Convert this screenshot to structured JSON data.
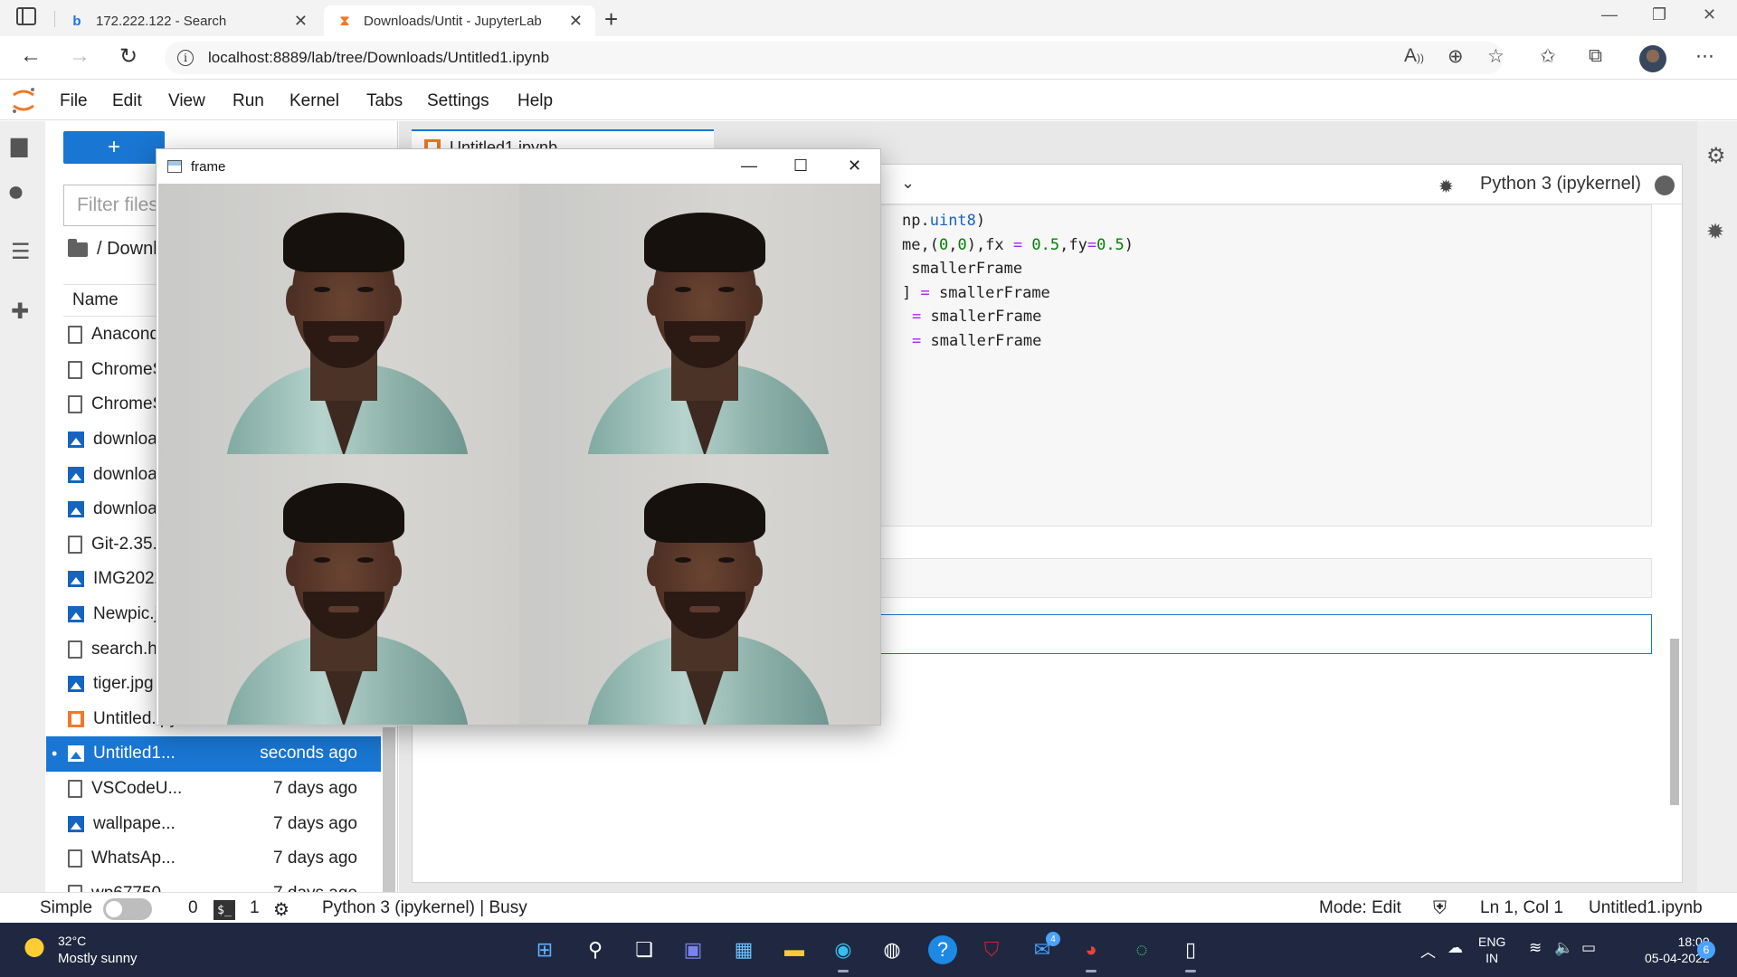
{
  "browser": {
    "tabs": [
      {
        "title": "172.222.122 - Search",
        "icon": "bing-icon"
      },
      {
        "title": "Downloads/Untit - JupyterLab",
        "icon": "jupyter-icon",
        "active": true
      }
    ],
    "url": "localhost:8889/lab/tree/Downloads/Untitled1.ipynb"
  },
  "jupyter": {
    "menu": [
      "File",
      "Edit",
      "View",
      "Run",
      "Kernel",
      "Tabs",
      "Settings",
      "Help"
    ],
    "filter_placeholder": "Filter files by name",
    "breadcrumb": "/ Downloads",
    "column_name": "Name",
    "files": [
      {
        "name": "Anaconda3-2021.11-Windows-x86_64.exe",
        "date": "",
        "type": "doc"
      },
      {
        "name": "ChromeSetup.exe",
        "date": "",
        "type": "doc"
      },
      {
        "name": "ChromeStandaloneSetup64.exe",
        "date": "",
        "type": "doc"
      },
      {
        "name": "download (1).jpg",
        "date": "",
        "type": "img"
      },
      {
        "name": "download (2).jpg",
        "date": "",
        "type": "img"
      },
      {
        "name": "download.jpg",
        "date": "",
        "type": "img"
      },
      {
        "name": "Git-2.35.1.2-64-bit.exe",
        "date": "",
        "type": "doc"
      },
      {
        "name": "IMG20220405.jpg",
        "date": "",
        "type": "img"
      },
      {
        "name": "Newpic.jpg",
        "date": "",
        "type": "img"
      },
      {
        "name": "search.html",
        "date": "",
        "type": "doc"
      },
      {
        "name": "tiger.jpg",
        "date": "",
        "type": "img"
      },
      {
        "name": "Untitled.ipynb",
        "date": "",
        "type": "nb"
      },
      {
        "name": "Untitled1...",
        "date": "seconds ago",
        "type": "img",
        "selected": true
      },
      {
        "name": "VSCodeU...",
        "date": "7 days ago",
        "type": "doc"
      },
      {
        "name": "wallpape...",
        "date": "7 days ago",
        "type": "img"
      },
      {
        "name": "WhatsAp...",
        "date": "7 days ago",
        "type": "doc"
      },
      {
        "name": "wp67750...",
        "date": "7 days ago",
        "type": "doc"
      }
    ],
    "notebook_tab": "Untitled1.ipynb",
    "kernel": "Python 3 (ipykernel)",
    "code_lines": [
      {
        "a": "np.",
        "b": "uint8",
        "c": ")"
      },
      {
        "a": "me,(",
        "n1": "0",
        "m": ",",
        "n2": "0",
        "d": "),fx ",
        "o1": "=",
        "e": " ",
        "n3": "0.5",
        "f": ",fy",
        "o2": "=",
        "n4": "0.5",
        "g": ")"
      },
      {
        "t": " smallerFrame"
      },
      {
        "t2": "] ",
        "o": "=",
        "t3": " smallerFrame"
      },
      {
        "o": "=",
        "t3": " smallerFrame"
      },
      {
        "o": "=",
        "t3": " smallerFrame"
      }
    ],
    "status": {
      "simple": "Simple",
      "count_a": "0",
      "count_b": "1",
      "kernel_status": "Python 3 (ipykernel) | Busy",
      "mode": "Mode: Edit",
      "cursor": "Ln 1, Col 1",
      "file": "Untitled1.ipynb"
    }
  },
  "frame_window": {
    "title": "frame",
    "tiles": 4
  },
  "taskbar": {
    "temperature": "32°C",
    "weather": "Mostly sunny",
    "lang_top": "ENG",
    "lang_bottom": "IN",
    "time": "18:00",
    "date": "05-04-2022",
    "notifications": "6",
    "teams_badge": "4"
  }
}
